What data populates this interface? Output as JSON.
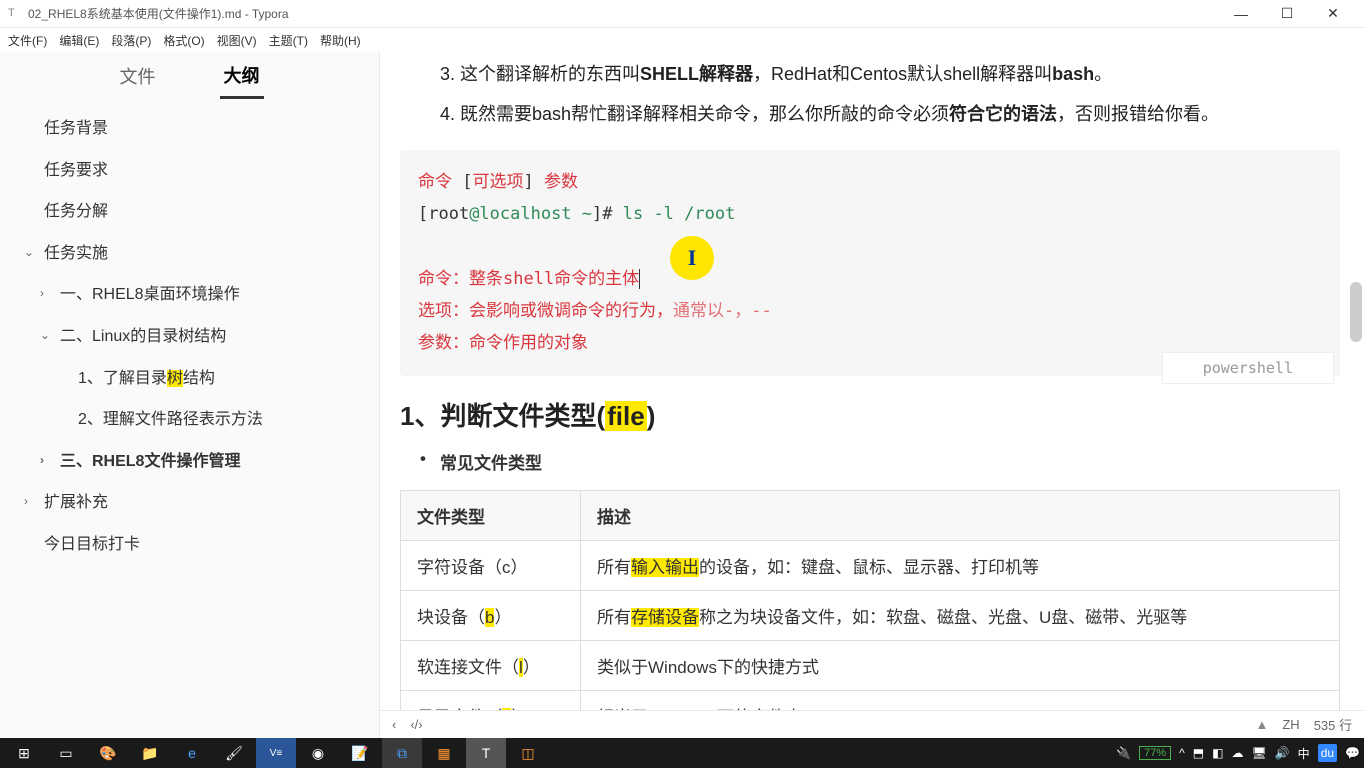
{
  "window": {
    "title": "02_RHEL8系统基本使用(文件操作1).md - Typora"
  },
  "menubar": [
    "文件(F)",
    "编辑(E)",
    "段落(P)",
    "格式(O)",
    "视图(V)",
    "主题(T)",
    "帮助(H)"
  ],
  "sidebar": {
    "tabs": {
      "files": "文件",
      "outline": "大纲"
    },
    "outline": [
      {
        "level": 1,
        "text": "任务背景",
        "chev": ""
      },
      {
        "level": 1,
        "text": "任务要求",
        "chev": ""
      },
      {
        "level": 1,
        "text": "任务分解",
        "chev": ""
      },
      {
        "level": 1,
        "text": "任务实施",
        "chev": "⌄"
      },
      {
        "level": 2,
        "text": "一、RHEL8桌面环境操作",
        "chev": "›"
      },
      {
        "level": 2,
        "text": "二、Linux的目录树结构",
        "chev": "⌄"
      },
      {
        "level": 3,
        "text_pre": "1、了解目录",
        "text_hl": "树",
        "text_post": "结构"
      },
      {
        "level": 3,
        "text": "2、理解文件路径表示方法"
      },
      {
        "level": 2,
        "text": "三、RHEL8文件操作管理",
        "chev": "›",
        "bold": true
      },
      {
        "level": 1,
        "text": "扩展补充",
        "chev": "›"
      },
      {
        "level": 1,
        "text": "今日目标打卡",
        "chev": ""
      }
    ]
  },
  "content": {
    "list3_pre": "3. 这个翻译解析的东西叫",
    "list3_b1": "SHELL解释器",
    "list3_mid": "，RedHat和Centos默认shell解释器叫",
    "list3_b2": "bash",
    "list3_end": "。",
    "list4_pre": "4. 既然需要bash帮忙翻译解释相关命令，那么你所敲的命令必须",
    "list4_b": "符合它的语法",
    "list4_end": "，否则报错给你看。",
    "code": {
      "l1a": "命令",
      "l1b": " [",
      "l1c": "可选项",
      "l1d": "] ",
      "l1e": "参数",
      "l2a": "[root",
      "l2b": "@localhost ~",
      "l2c": "]# ",
      "l2d": "ls -l /root",
      "l4": "命令：整条shell命令的主体",
      "l5a": "选项：会影响或微调命令的行为，",
      "l5b": "通常以-，--",
      "l6": "参数：命令作用的对象",
      "lang": "powershell"
    },
    "h2_pre": "1、判断文件类型(",
    "h2_hl": "file",
    "h2_post": ")",
    "bullet": "常见文件类型",
    "table": {
      "h1": "文件类型",
      "h2": "描述",
      "rows": [
        {
          "c1": "字符设备（c）",
          "c2_pre": "所有",
          "c2_hl": "输入输出",
          "c2_post": "的设备，如：键盘、鼠标、显示器、打印机等"
        },
        {
          "c1_pre": "块设备（",
          "c1_hl": "b",
          "c1_post": "）",
          "c2_pre": "所有",
          "c2_hl": "存储设备",
          "c2_post": "称之为块设备文件，如：软盘、磁盘、光盘、U盘、磁带、光驱等"
        },
        {
          "c1_pre": "软连接文件（",
          "c1_hl": "l",
          "c1_post": "）",
          "c2": "类似于Windows下的快捷方式"
        },
        {
          "c1_pre": "目录文件（",
          "c1_hl": "d",
          "c1_post": "）",
          "c2": "相当于Windows下的文件夹"
        }
      ]
    }
  },
  "statusbar": {
    "nav1": "‹",
    "nav2": "‹/›",
    "warn": "▲",
    "lang": "ZH",
    "lines": "535 行"
  },
  "taskbar": {
    "battery": "77%"
  }
}
